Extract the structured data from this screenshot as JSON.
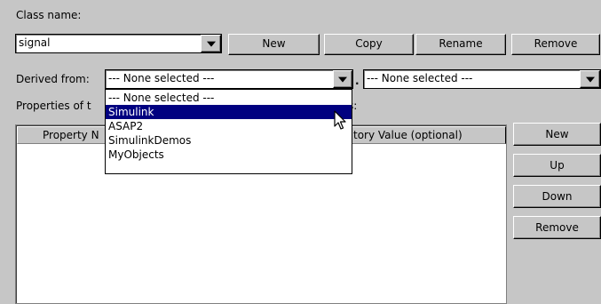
{
  "labels": {
    "class_name": "Class name:",
    "derived_from": "Derived from:",
    "properties_of": "Properties of t",
    "properties_tail": "s:",
    "dot_separator": "."
  },
  "class_select": {
    "value": "signal",
    "icon": "chevron-down-icon"
  },
  "class_buttons": {
    "new": "New",
    "copy": "Copy",
    "rename": "Rename",
    "remove": "Remove"
  },
  "derived_from": {
    "package_value": "--- None selected ---",
    "class_value": "--- None selected ---",
    "icon": "chevron-down-icon"
  },
  "dropdown": {
    "items": [
      "--- None selected ---",
      "Simulink",
      "ASAP2",
      "SimulinkDemos",
      "MyObjects"
    ],
    "selected": "Simulink",
    "cursor_icon": "mouse-pointer-icon"
  },
  "table": {
    "columns": [
      "Property N",
      "tory Value (optional)"
    ]
  },
  "property_buttons": {
    "new": "New",
    "up": "Up",
    "down": "Down",
    "remove": "Remove"
  },
  "colors": {
    "selection": "#000080",
    "background": "#c6c6c6"
  }
}
